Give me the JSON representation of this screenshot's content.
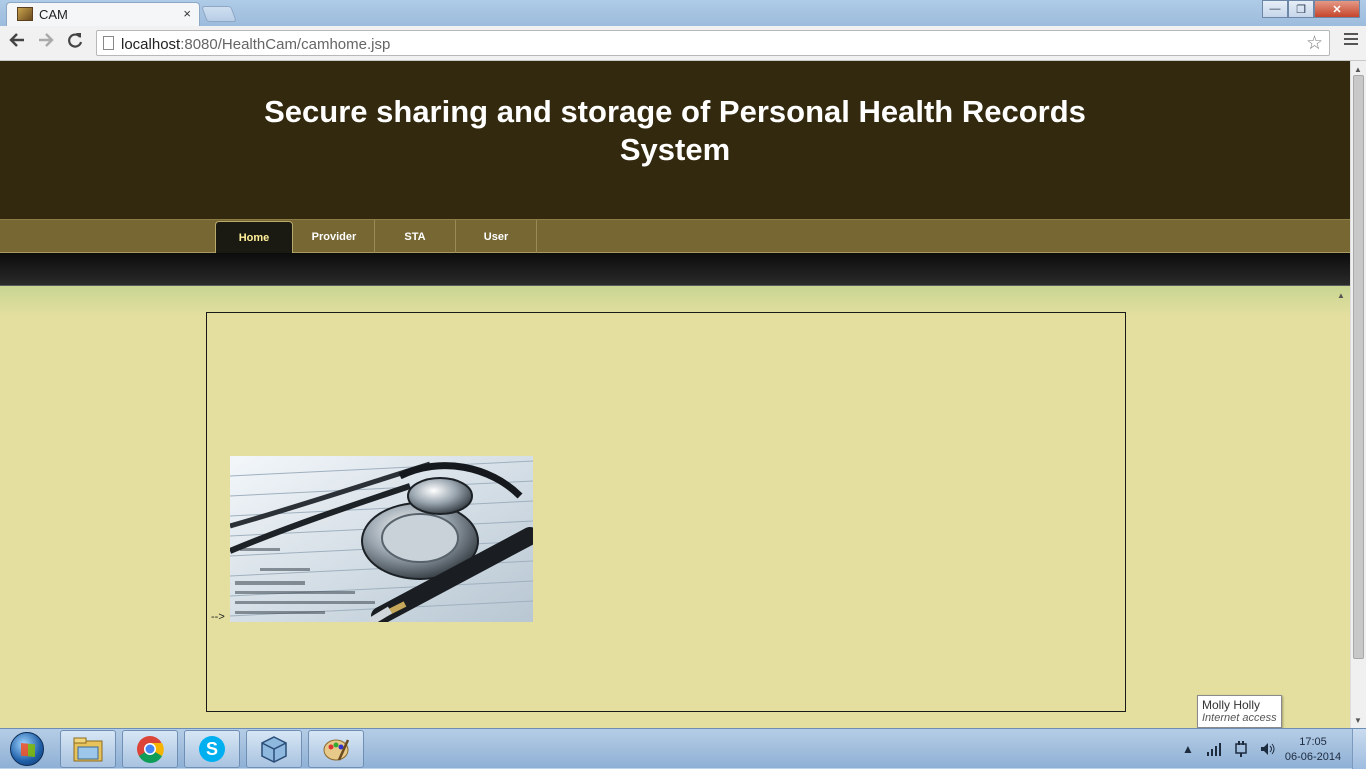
{
  "browser": {
    "tab_title": "CAM",
    "tab_close": "×",
    "url_host": "localhost",
    "url_rest": ":8080/HealthCam/camhome.jsp",
    "back_icon": "back-arrow-icon",
    "forward_icon": "forward-arrow-icon",
    "reload_icon": "reload-icon",
    "bookmark_icon": "star-icon",
    "menu_icon": "hamburger-menu-icon",
    "window_controls": {
      "minimize": "—",
      "maximize": "❐",
      "close": "✕"
    }
  },
  "site": {
    "title_line1": "Secure sharing and storage of Personal Health Records",
    "title_line2": "System",
    "nav": [
      {
        "label": "Home",
        "active": true
      },
      {
        "label": "Provider",
        "active": false
      },
      {
        "label": "STA",
        "active": false
      },
      {
        "label": "User",
        "active": false
      }
    ],
    "comment_arrow": "-->",
    "image": "stethoscope-and-pen-on-medical-form"
  },
  "colors": {
    "header_bg": "#32290e",
    "nav_bg": "#776733",
    "active_tab_text": "#ffef9a",
    "content_bg": "#e4df9f"
  },
  "tooltip": {
    "name": "Molly Holly",
    "status": "Internet access"
  },
  "taskbar": {
    "apps": [
      "windows-explorer-icon",
      "chrome-icon",
      "skype-icon",
      "virtualbox-icon",
      "paint-icon"
    ],
    "time": "17:05",
    "date": "06-06-2014"
  }
}
